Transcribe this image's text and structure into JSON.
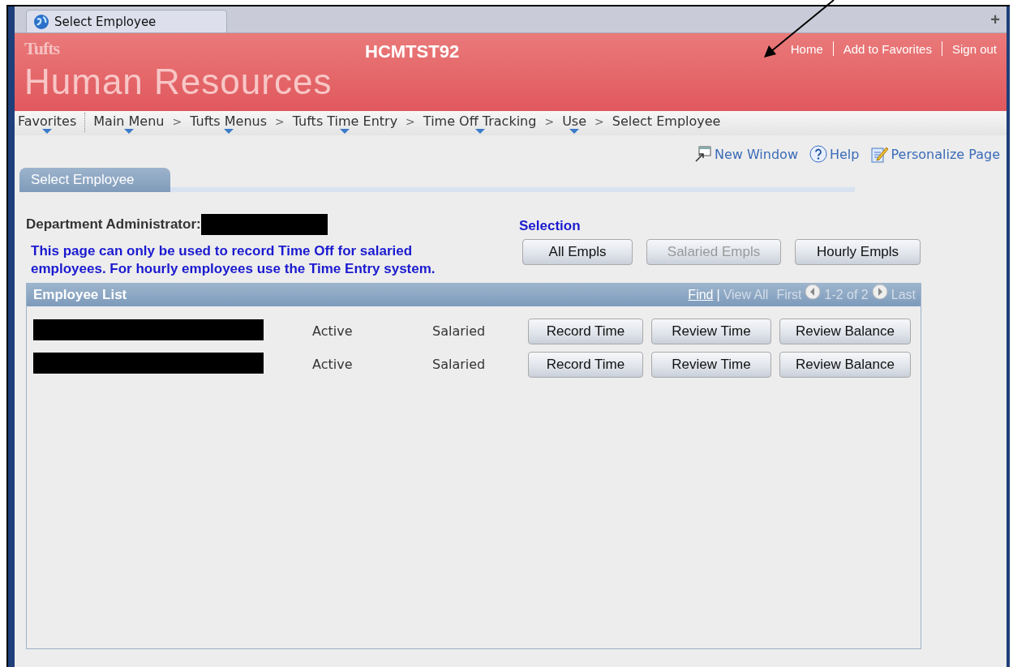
{
  "browser_tab": {
    "title": "Select Employee",
    "new_tab": "+"
  },
  "header": {
    "logo": "Tufts",
    "system": "HCMTST92",
    "title": "Human Resources",
    "links": [
      "Home",
      "Add to Favorites",
      "Sign out"
    ]
  },
  "breadcrumbs": [
    {
      "label": "Favorites",
      "dropdown": true
    },
    {
      "label": "Main Menu",
      "dropdown": true
    },
    {
      "label": "Tufts Menus",
      "dropdown": true
    },
    {
      "label": "Tufts Time Entry",
      "dropdown": true
    },
    {
      "label": "Time Off Tracking",
      "dropdown": true
    },
    {
      "label": "Use",
      "dropdown": true
    },
    {
      "label": "Select Employee",
      "dropdown": false
    }
  ],
  "breadcrumb_separator": ">",
  "page_links": [
    {
      "kind": "window",
      "label": "New Window"
    },
    {
      "kind": "help",
      "label": "Help"
    },
    {
      "kind": "personalize",
      "label": "Personalize Page"
    }
  ],
  "page_tabs": [
    {
      "label": "Select Employee",
      "selected": true
    }
  ],
  "admin": {
    "label": "Department Administrator:",
    "redacted": true
  },
  "notice": "This page can only be used to record Time Off for salaried employees. For hourly employees use the Time Entry system.",
  "selection": {
    "title": "Selection",
    "buttons": [
      {
        "label": "All Empls",
        "disabled": false
      },
      {
        "label": "Salaried Empls",
        "disabled": true
      },
      {
        "label": "Hourly Empls",
        "disabled": false
      }
    ]
  },
  "employee_list": {
    "title": "Employee List",
    "find": "Find",
    "separator": "|",
    "view_all": "View All",
    "first": "First",
    "range": "1-2 of 2",
    "last": "Last",
    "rows": [
      {
        "redacted": true,
        "status": "Active",
        "type": "Salaried",
        "buttons": [
          "Record Time",
          "Review Time",
          "Review Balance"
        ]
      },
      {
        "redacted": true,
        "status": "Active",
        "type": "Salaried",
        "buttons": [
          "Record Time",
          "Review Time",
          "Review Balance"
        ]
      }
    ]
  },
  "annotation": {
    "arrow": true
  }
}
